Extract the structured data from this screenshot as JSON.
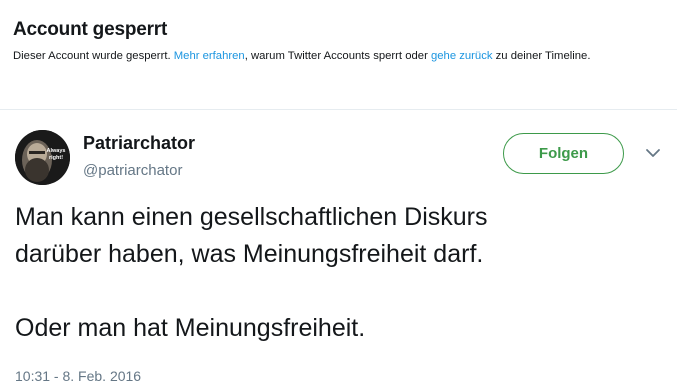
{
  "banner": {
    "title": "Account gesperrt",
    "text_1": "Dieser Account wurde gesperrt. ",
    "link_learn_more": "Mehr erfahren",
    "text_2": ", warum Twitter Accounts sperrt oder ",
    "link_go_back": "gehe zurück",
    "text_3": " zu deiner Timeline."
  },
  "tweet": {
    "avatar_caption_line1": "Always",
    "avatar_caption_line2": "right!",
    "display_name": "Patriarchator",
    "handle": "@patriarchator",
    "follow_label": "Folgen",
    "text": "Man kann einen gesellschaftlichen Diskurs\ndarüber haben, was Meinungsfreiheit darf.\n\nOder man hat Meinungsfreiheit.",
    "timestamp": "10:31 - 8. Feb. 2016"
  },
  "colors": {
    "link": "#1b95e0",
    "follow_green": "#3d9a4a",
    "secondary_text": "#657786",
    "primary_text": "#14171a"
  },
  "icons": {
    "caret": "chevron-down-icon"
  }
}
